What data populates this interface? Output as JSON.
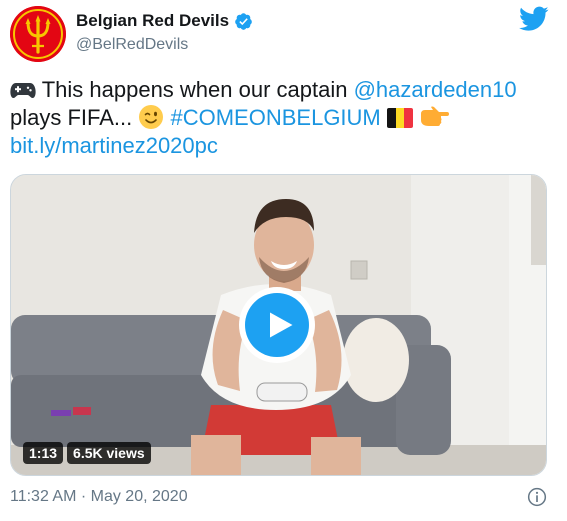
{
  "account": {
    "display_name": "Belgian Red Devils",
    "handle": "@BelRedDevils",
    "verified": true,
    "avatar_icon": "red-devils-trident-logo"
  },
  "tweet": {
    "gamepad_emoji": "🎮",
    "text_part1": "This happens when our captain ",
    "mention": "@hazardeden10",
    "text_part2": " plays FIFA... ",
    "wink_emoji": "😉",
    "hashtag": "#COMEONBELGIUM",
    "flag_emoji": "🇧🇪",
    "pointing_emoji": "👉",
    "link": "bit.ly/martinez2020pc"
  },
  "media": {
    "duration": "1:13",
    "views": "6.5K views",
    "play_icon": "play-icon"
  },
  "footer": {
    "timestamp": "11:32 AM · May 20, 2020",
    "info_icon": "info-icon"
  },
  "colors": {
    "link_blue": "#1b95e0",
    "twitter_blue": "#1da1f2",
    "secondary_text": "#657786",
    "avatar_red": "#e30613"
  }
}
